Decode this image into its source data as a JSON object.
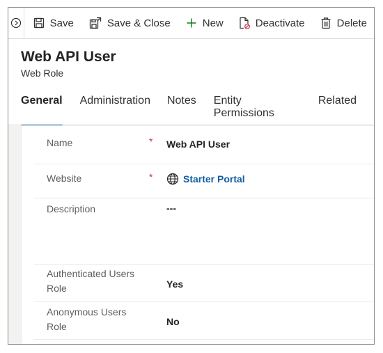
{
  "toolbar": {
    "expand_icon": "chevron-right-circle-icon",
    "buttons": [
      {
        "label": "Save",
        "icon": "save-icon"
      },
      {
        "label": "Save & Close",
        "icon": "save-close-icon"
      },
      {
        "label": "New",
        "icon": "plus-icon"
      },
      {
        "label": "Deactivate",
        "icon": "deactivate-icon"
      },
      {
        "label": "Delete",
        "icon": "trash-icon"
      }
    ]
  },
  "header": {
    "title": "Web API User",
    "entity_type": "Web Role"
  },
  "tabs": [
    {
      "label": "General",
      "active": true
    },
    {
      "label": "Administration",
      "active": false
    },
    {
      "label": "Notes",
      "active": false
    },
    {
      "label": "Entity Permissions",
      "active": false
    },
    {
      "label": "Related",
      "active": false
    }
  ],
  "fields": {
    "name": {
      "label": "Name",
      "required": "*",
      "value": "Web API User"
    },
    "website": {
      "label": "Website",
      "required": "*",
      "value": "Starter Portal",
      "icon": "globe-icon"
    },
    "description": {
      "label": "Description",
      "value": "---"
    },
    "authenticated": {
      "label_line1": "Authenticated Users",
      "label_line2": "Role",
      "value": "Yes"
    },
    "anonymous": {
      "label_line1": "Anonymous Users",
      "label_line2": "Role",
      "value": "No"
    }
  },
  "colors": {
    "accent": "#0f6cbd",
    "link": "#115ea3",
    "required": "#c4314b",
    "new_icon": "#107c10"
  }
}
